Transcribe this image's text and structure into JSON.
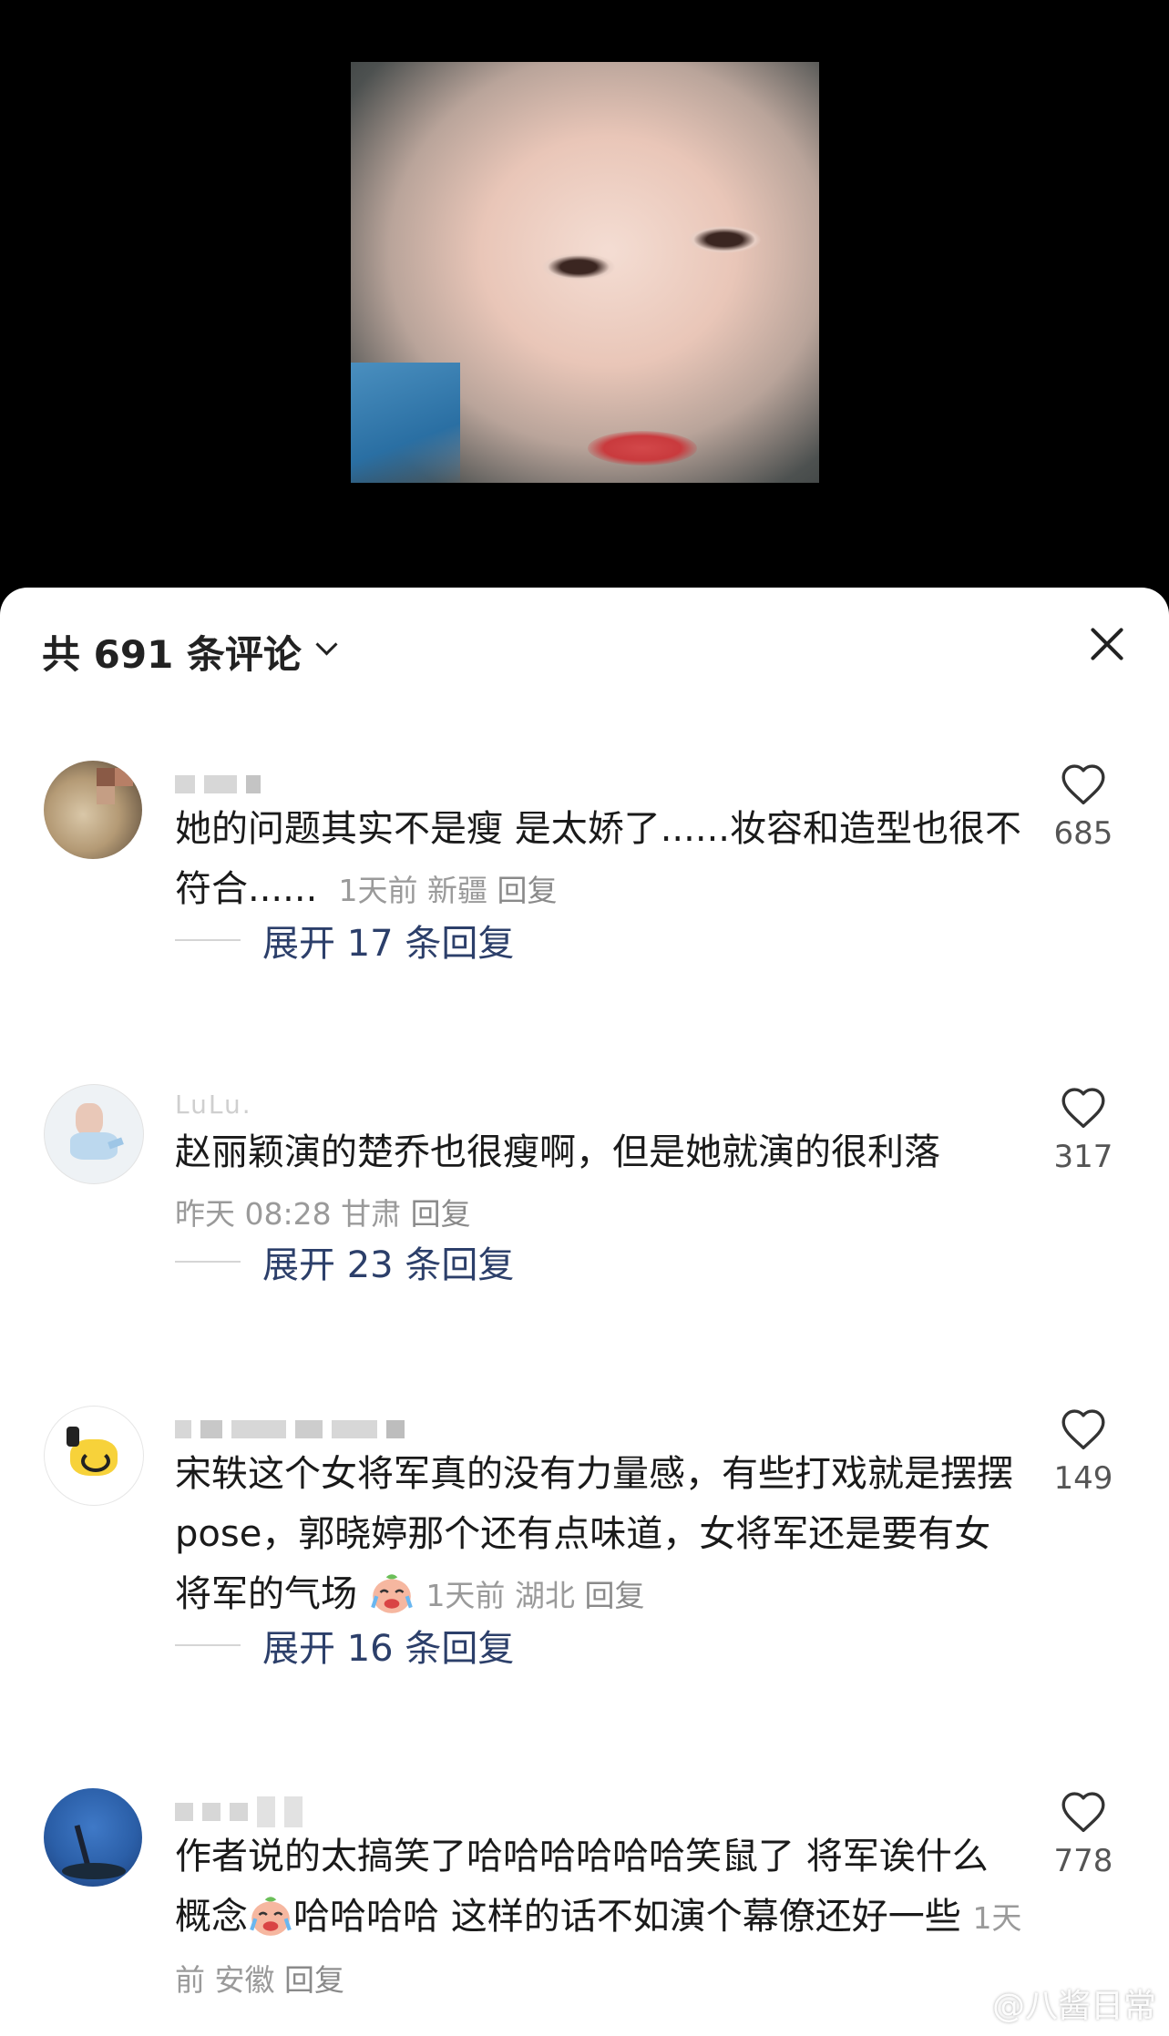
{
  "header": {
    "comment_count_label": "共 691 条评论"
  },
  "comments": [
    {
      "username": "",
      "text": "她的问题其实不是瘦 是太娇了......妆容和造型也很不符合......",
      "time": "1天前",
      "location": "新疆",
      "reply_label": "回复",
      "likes": "685",
      "expand_label": "展开 17 条回复"
    },
    {
      "username": "LuLu.",
      "text": "赵丽颖演的楚乔也很瘦啊，但是她就演的很利落",
      "time": "昨天 08:28",
      "location": "甘肃",
      "reply_label": "回复",
      "likes": "317",
      "expand_label": "展开 23 条回复"
    },
    {
      "username": "",
      "text": "宋轶这个女将军真的没有力量感，有些打戏就是摆摆pose，郭晓婷那个还有点味道，女将军还是要有女将军的气场",
      "time": "1天前",
      "location": "湖北",
      "reply_label": "回复",
      "likes": "149",
      "expand_label": "展开 16 条回复"
    },
    {
      "username": "",
      "text_part1": "作者说的太搞笑了哈哈哈哈哈哈笑鼠了 将军诶什么概念",
      "text_part2": "哈哈哈哈 这样的话不如演个幕僚还好一些",
      "time": "1天前",
      "location": "安徽",
      "reply_label": "回复",
      "likes": "778"
    }
  ],
  "watermark": "@八酱日常",
  "colors": {
    "sheet_bg": "#ffffff",
    "text": "#1a1a1a",
    "meta": "#9a9a9a",
    "expand": "#2c3f6a"
  }
}
